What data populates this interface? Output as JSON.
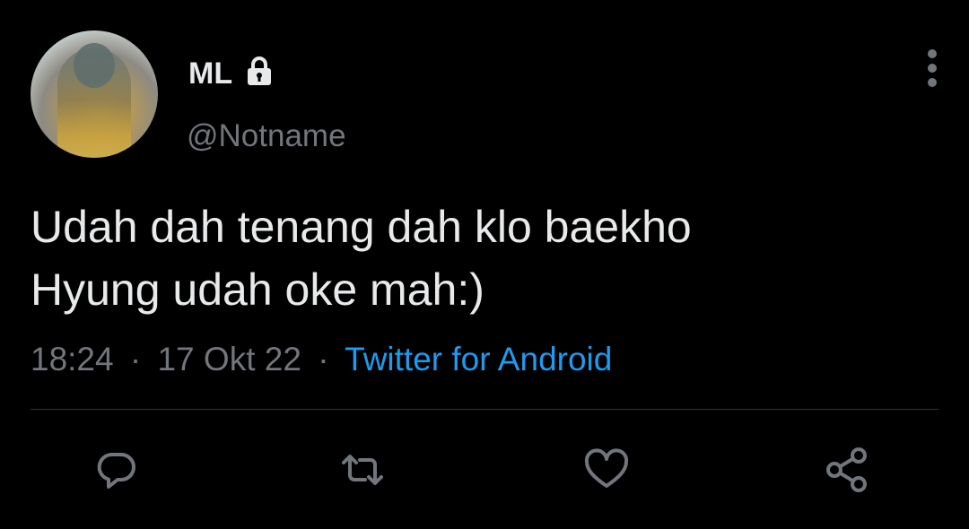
{
  "user": {
    "display_name": "ML",
    "handle": "@Notname",
    "protected_icon": "lock-icon",
    "avatar_icon": "avatar"
  },
  "tweet": {
    "text": "Udah dah tenang dah klo baekho\nHyung udah oke mah:)",
    "time": "18:24",
    "date": "17 Okt 22",
    "separator": "·",
    "source": "Twitter for Android"
  },
  "actions": [
    {
      "name": "reply",
      "icon": "reply-icon"
    },
    {
      "name": "retweet",
      "icon": "retweet-icon"
    },
    {
      "name": "like",
      "icon": "heart-icon"
    },
    {
      "name": "share",
      "icon": "share-icon"
    }
  ],
  "colors": {
    "background": "#000000",
    "text": "#e7e9ea",
    "muted": "#71767b",
    "link": "#1d9bf0",
    "divider": "#2f3336"
  }
}
